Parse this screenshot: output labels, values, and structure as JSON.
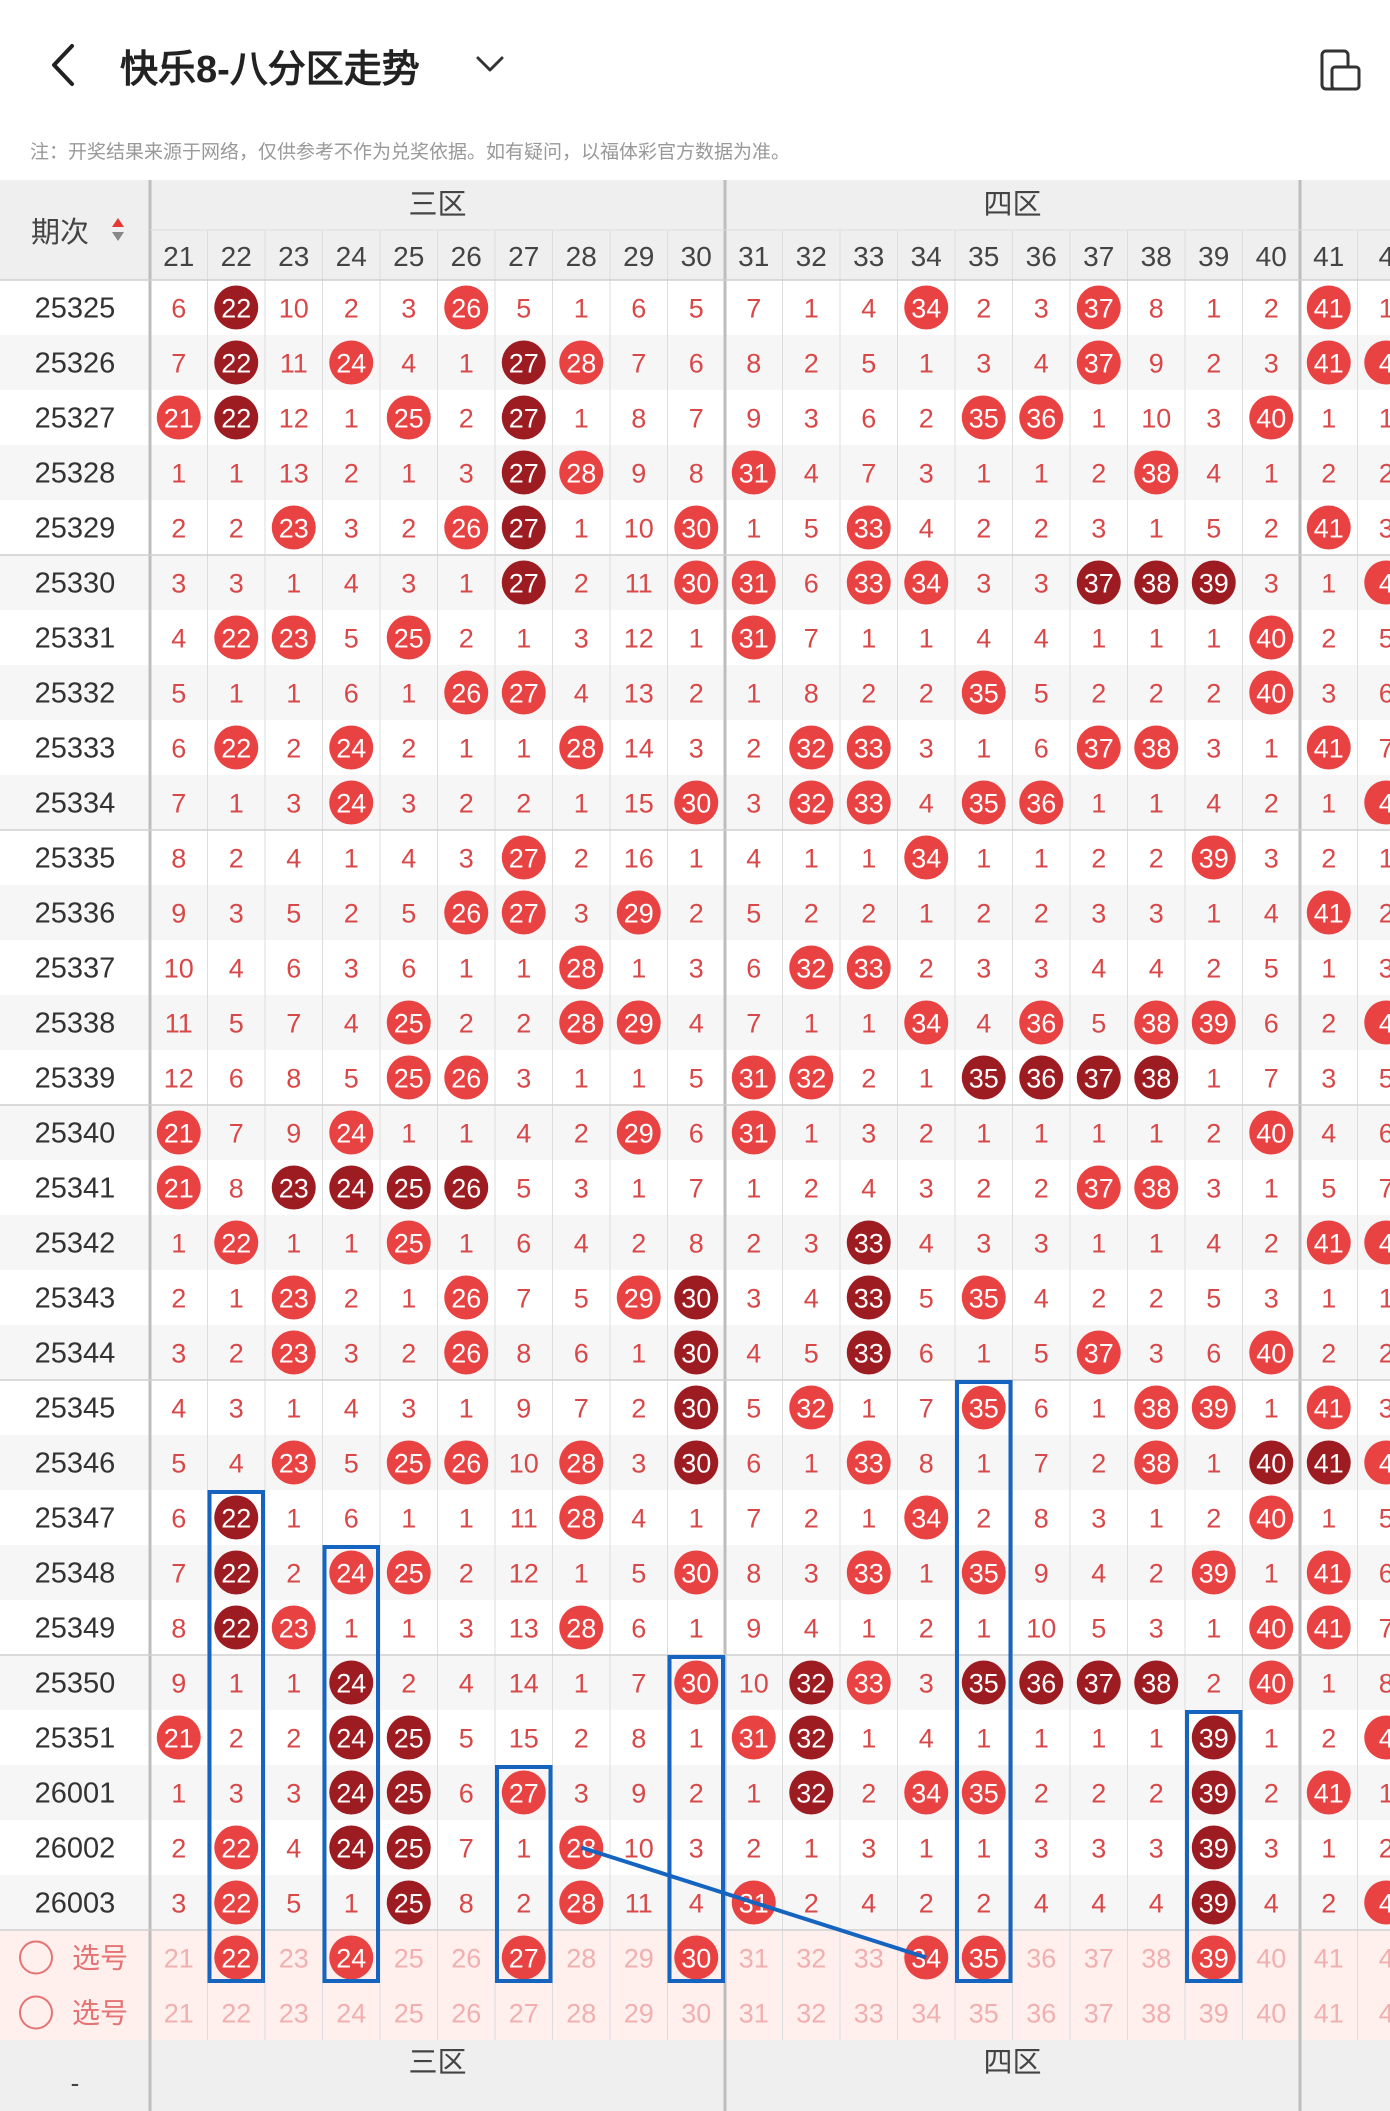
{
  "header": {
    "title": "快乐8-八分区走势",
    "notice": "注：开奖结果来源于网络，仅供参考不作为兑奖依据。如有疑问，以福体彩官方数据为准。"
  },
  "table": {
    "period_header": "期次",
    "zones": [
      {
        "label": "三区",
        "numbers": [
          "21",
          "22",
          "23",
          "24",
          "25",
          "26",
          "27",
          "28",
          "29",
          "30"
        ]
      },
      {
        "label": "四区",
        "numbers": [
          "31",
          "32",
          "33",
          "34",
          "35",
          "36",
          "37",
          "38",
          "39",
          "40"
        ]
      }
    ],
    "partial_columns": [
      "41",
      "4"
    ],
    "rows": [
      {
        "period": "25325",
        "cells": [
          "6",
          "22",
          "10",
          "2",
          "3",
          "26",
          "5",
          "1",
          "6",
          "5",
          "7",
          "1",
          "4",
          "34",
          "2",
          "3",
          "37",
          "8",
          "1",
          "2",
          "41",
          "1"
        ],
        "dark": [
          1
        ]
      },
      {
        "period": "25326",
        "cells": [
          "7",
          "22",
          "11",
          "24",
          "4",
          "1",
          "27",
          "28",
          "7",
          "6",
          "8",
          "2",
          "5",
          "1",
          "3",
          "4",
          "37",
          "9",
          "2",
          "3",
          "41",
          "4"
        ],
        "dark": [
          1,
          6
        ]
      },
      {
        "period": "25327",
        "cells": [
          "21",
          "22",
          "12",
          "1",
          "25",
          "2",
          "27",
          "1",
          "8",
          "7",
          "9",
          "3",
          "6",
          "2",
          "35",
          "36",
          "1",
          "10",
          "3",
          "40",
          "1",
          "1"
        ],
        "dark": [
          1,
          6
        ]
      },
      {
        "period": "25328",
        "cells": [
          "1",
          "1",
          "13",
          "2",
          "1",
          "3",
          "27",
          "28",
          "9",
          "8",
          "31",
          "4",
          "7",
          "3",
          "1",
          "1",
          "2",
          "38",
          "4",
          "1",
          "2",
          "2"
        ],
        "dark": [
          6
        ]
      },
      {
        "period": "25329",
        "cells": [
          "2",
          "2",
          "23",
          "3",
          "2",
          "26",
          "27",
          "1",
          "10",
          "30",
          "1",
          "5",
          "33",
          "4",
          "2",
          "2",
          "3",
          "1",
          "5",
          "2",
          "41",
          "3"
        ],
        "dark": [
          6
        ]
      },
      {
        "period": "25330",
        "cells": [
          "3",
          "3",
          "1",
          "4",
          "3",
          "1",
          "27",
          "2",
          "11",
          "30",
          "31",
          "6",
          "33",
          "34",
          "3",
          "3",
          "37",
          "38",
          "39",
          "3",
          "1",
          "4"
        ],
        "dark": [
          6,
          16,
          17,
          18
        ]
      },
      {
        "period": "25331",
        "cells": [
          "4",
          "22",
          "23",
          "5",
          "25",
          "2",
          "1",
          "3",
          "12",
          "1",
          "31",
          "7",
          "1",
          "1",
          "4",
          "4",
          "1",
          "1",
          "1",
          "40",
          "2",
          "5"
        ],
        "dark": []
      },
      {
        "period": "25332",
        "cells": [
          "5",
          "1",
          "1",
          "6",
          "1",
          "26",
          "27",
          "4",
          "13",
          "2",
          "1",
          "8",
          "2",
          "2",
          "35",
          "5",
          "2",
          "2",
          "2",
          "40",
          "3",
          "6"
        ],
        "dark": []
      },
      {
        "period": "25333",
        "cells": [
          "6",
          "22",
          "2",
          "24",
          "2",
          "1",
          "1",
          "28",
          "14",
          "3",
          "2",
          "32",
          "33",
          "3",
          "1",
          "6",
          "37",
          "38",
          "3",
          "1",
          "41",
          "7"
        ],
        "dark": []
      },
      {
        "period": "25334",
        "cells": [
          "7",
          "1",
          "3",
          "24",
          "3",
          "2",
          "2",
          "1",
          "15",
          "30",
          "3",
          "32",
          "33",
          "4",
          "35",
          "36",
          "1",
          "1",
          "4",
          "2",
          "1",
          "4"
        ],
        "dark": []
      },
      {
        "period": "25335",
        "cells": [
          "8",
          "2",
          "4",
          "1",
          "4",
          "3",
          "27",
          "2",
          "16",
          "1",
          "4",
          "1",
          "1",
          "34",
          "1",
          "1",
          "2",
          "2",
          "39",
          "3",
          "2",
          "1"
        ],
        "dark": []
      },
      {
        "period": "25336",
        "cells": [
          "9",
          "3",
          "5",
          "2",
          "5",
          "26",
          "27",
          "3",
          "29",
          "2",
          "5",
          "2",
          "2",
          "1",
          "2",
          "2",
          "3",
          "3",
          "1",
          "4",
          "41",
          "2"
        ],
        "dark": []
      },
      {
        "period": "25337",
        "cells": [
          "10",
          "4",
          "6",
          "3",
          "6",
          "1",
          "1",
          "28",
          "1",
          "3",
          "6",
          "32",
          "33",
          "2",
          "3",
          "3",
          "4",
          "4",
          "2",
          "5",
          "1",
          "3"
        ],
        "dark": []
      },
      {
        "period": "25338",
        "cells": [
          "11",
          "5",
          "7",
          "4",
          "25",
          "2",
          "2",
          "28",
          "29",
          "4",
          "7",
          "1",
          "1",
          "34",
          "4",
          "36",
          "5",
          "38",
          "39",
          "6",
          "2",
          "4"
        ],
        "dark": []
      },
      {
        "period": "25339",
        "cells": [
          "12",
          "6",
          "8",
          "5",
          "25",
          "26",
          "3",
          "1",
          "1",
          "5",
          "31",
          "32",
          "2",
          "1",
          "35",
          "36",
          "37",
          "38",
          "1",
          "7",
          "3",
          "5"
        ],
        "dark": [
          14,
          15,
          16,
          17
        ]
      },
      {
        "period": "25340",
        "cells": [
          "21",
          "7",
          "9",
          "24",
          "1",
          "1",
          "4",
          "2",
          "29",
          "6",
          "31",
          "1",
          "3",
          "2",
          "1",
          "1",
          "1",
          "1",
          "2",
          "40",
          "4",
          "6"
        ],
        "dark": []
      },
      {
        "period": "25341",
        "cells": [
          "21",
          "8",
          "23",
          "24",
          "25",
          "26",
          "5",
          "3",
          "1",
          "7",
          "1",
          "2",
          "4",
          "3",
          "2",
          "2",
          "37",
          "38",
          "3",
          "1",
          "5",
          "7"
        ],
        "dark": [
          2,
          3,
          4,
          5
        ]
      },
      {
        "period": "25342",
        "cells": [
          "1",
          "22",
          "1",
          "1",
          "25",
          "1",
          "6",
          "4",
          "2",
          "8",
          "2",
          "3",
          "33",
          "4",
          "3",
          "3",
          "1",
          "1",
          "4",
          "2",
          "41",
          "4"
        ],
        "dark": [
          12
        ]
      },
      {
        "period": "25343",
        "cells": [
          "2",
          "1",
          "23",
          "2",
          "1",
          "26",
          "7",
          "5",
          "29",
          "30",
          "3",
          "4",
          "33",
          "5",
          "35",
          "4",
          "2",
          "2",
          "5",
          "3",
          "1",
          "1"
        ],
        "dark": [
          9,
          12
        ]
      },
      {
        "period": "25344",
        "cells": [
          "3",
          "2",
          "23",
          "3",
          "2",
          "26",
          "8",
          "6",
          "1",
          "30",
          "4",
          "5",
          "33",
          "6",
          "1",
          "5",
          "37",
          "3",
          "6",
          "40",
          "2",
          "2"
        ],
        "dark": [
          9,
          12
        ]
      },
      {
        "period": "25345",
        "cells": [
          "4",
          "3",
          "1",
          "4",
          "3",
          "1",
          "9",
          "7",
          "2",
          "30",
          "5",
          "32",
          "1",
          "7",
          "35",
          "6",
          "1",
          "38",
          "39",
          "1",
          "41",
          "3"
        ],
        "dark": [
          9
        ]
      },
      {
        "period": "25346",
        "cells": [
          "5",
          "4",
          "23",
          "5",
          "25",
          "26",
          "10",
          "28",
          "3",
          "30",
          "6",
          "1",
          "33",
          "8",
          "1",
          "7",
          "2",
          "38",
          "1",
          "40",
          "41",
          "4"
        ],
        "dark": [
          9,
          19,
          20
        ]
      },
      {
        "period": "25347",
        "cells": [
          "6",
          "22",
          "1",
          "6",
          "1",
          "1",
          "11",
          "28",
          "4",
          "1",
          "7",
          "2",
          "1",
          "34",
          "2",
          "8",
          "3",
          "1",
          "2",
          "40",
          "1",
          "5"
        ],
        "dark": [
          1
        ]
      },
      {
        "period": "25348",
        "cells": [
          "7",
          "22",
          "2",
          "24",
          "25",
          "2",
          "12",
          "1",
          "5",
          "30",
          "8",
          "3",
          "33",
          "1",
          "35",
          "9",
          "4",
          "2",
          "39",
          "1",
          "41",
          "6"
        ],
        "dark": [
          1
        ]
      },
      {
        "period": "25349",
        "cells": [
          "8",
          "22",
          "23",
          "1",
          "1",
          "3",
          "13",
          "28",
          "6",
          "1",
          "9",
          "4",
          "1",
          "2",
          "1",
          "10",
          "5",
          "3",
          "1",
          "40",
          "41",
          "7"
        ],
        "dark": [
          1
        ]
      },
      {
        "period": "25350",
        "cells": [
          "9",
          "1",
          "1",
          "24",
          "2",
          "4",
          "14",
          "1",
          "7",
          "30",
          "10",
          "32",
          "33",
          "3",
          "35",
          "36",
          "37",
          "38",
          "2",
          "40",
          "1",
          "8"
        ],
        "dark": [
          3,
          11,
          14,
          15,
          16,
          17
        ]
      },
      {
        "period": "25351",
        "cells": [
          "21",
          "2",
          "2",
          "24",
          "25",
          "5",
          "15",
          "2",
          "8",
          "1",
          "31",
          "32",
          "1",
          "4",
          "1",
          "1",
          "1",
          "1",
          "39",
          "1",
          "2",
          "4"
        ],
        "dark": [
          3,
          4,
          11,
          18
        ]
      },
      {
        "period": "26001",
        "cells": [
          "1",
          "3",
          "3",
          "24",
          "25",
          "6",
          "27",
          "3",
          "9",
          "2",
          "1",
          "32",
          "2",
          "34",
          "35",
          "2",
          "2",
          "2",
          "39",
          "2",
          "41",
          "1"
        ],
        "dark": [
          3,
          4,
          11,
          18
        ]
      },
      {
        "period": "26002",
        "cells": [
          "2",
          "22",
          "4",
          "24",
          "25",
          "7",
          "1",
          "28",
          "10",
          "3",
          "2",
          "1",
          "3",
          "1",
          "1",
          "3",
          "3",
          "3",
          "39",
          "3",
          "1",
          "2"
        ],
        "dark": [
          3,
          4,
          18
        ]
      },
      {
        "period": "26003",
        "cells": [
          "3",
          "22",
          "5",
          "1",
          "25",
          "8",
          "2",
          "28",
          "11",
          "4",
          "31",
          "2",
          "4",
          "2",
          "2",
          "4",
          "4",
          "4",
          "39",
          "4",
          "2",
          "4"
        ],
        "dark": [
          4,
          18
        ]
      }
    ],
    "pick_rows": [
      {
        "label": "选号",
        "selected": [
          "22",
          "24",
          "27",
          "30",
          "34",
          "35",
          "39"
        ]
      },
      {
        "label": "选号",
        "selected": []
      }
    ],
    "footer": {
      "period_label": "-"
    }
  },
  "colors": {
    "ball_red": "#E94242",
    "ball_dark": "#9C1C22",
    "miss_text": "#D94848",
    "annotation": "#1565C0",
    "header_bg": "#EFEFEF",
    "pick_bg": "#FFF0EE"
  }
}
